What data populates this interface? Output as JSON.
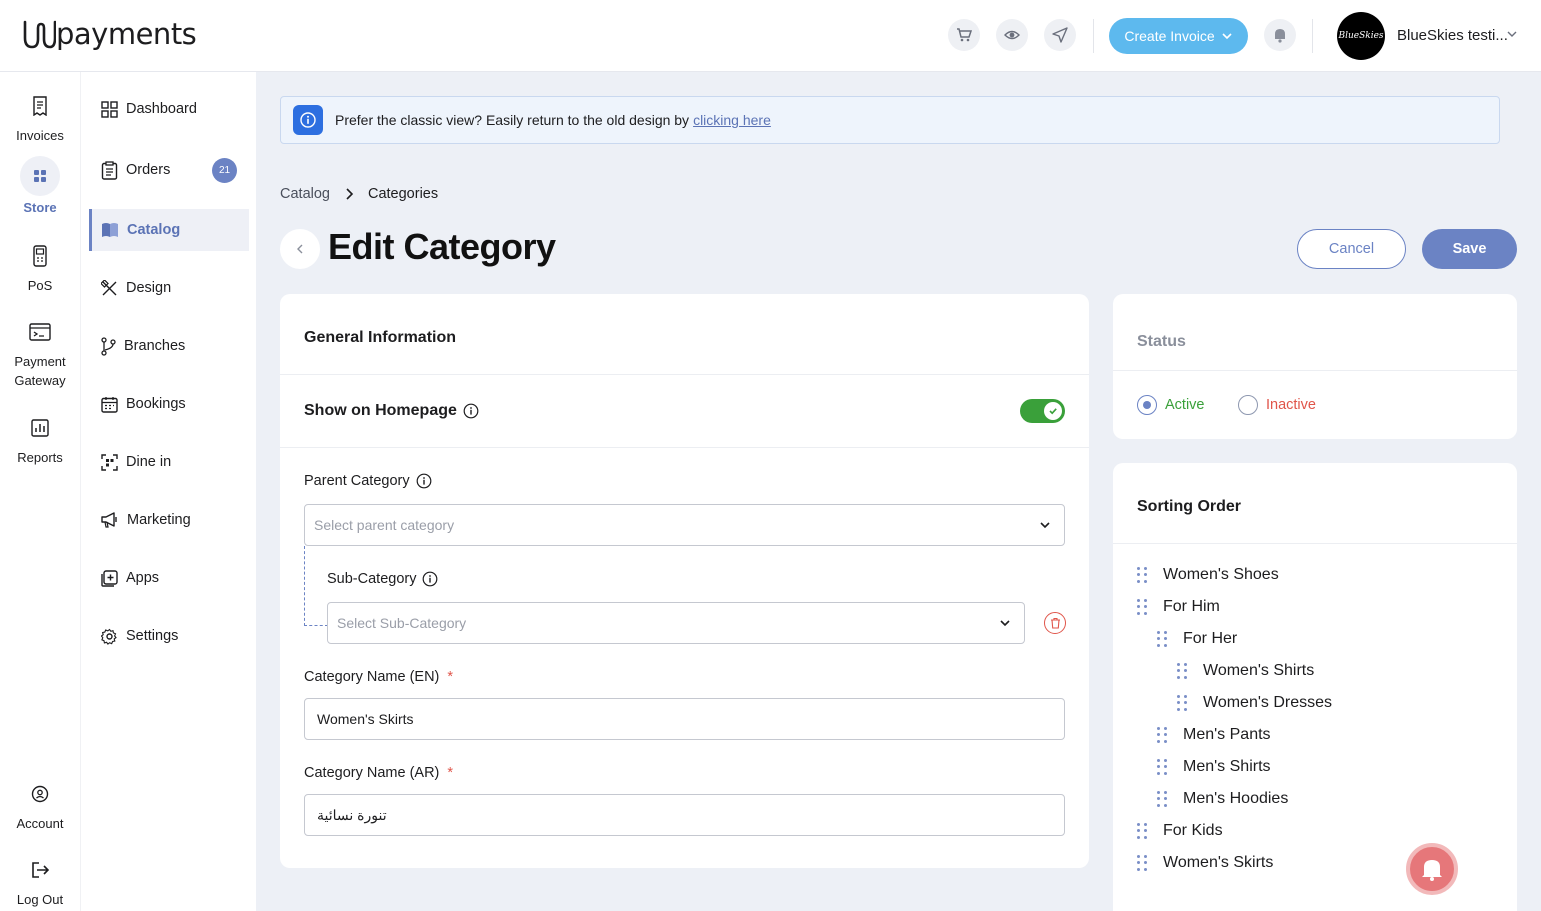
{
  "brand": {
    "name": "payments"
  },
  "header": {
    "create_invoice_label": "Create Invoice",
    "avatar_text": "BlueSkies",
    "user_name": "BlueSkies testi..."
  },
  "rail": {
    "items": [
      {
        "label": "Invoices"
      },
      {
        "label": "Store",
        "active": true
      },
      {
        "label": "PoS"
      },
      {
        "label": "Payment Gateway"
      },
      {
        "label": "Reports"
      },
      {
        "label": "Account"
      },
      {
        "label": "Log Out"
      }
    ]
  },
  "nav": {
    "items": [
      {
        "label": "Dashboard"
      },
      {
        "label": "Orders",
        "badge": "21"
      },
      {
        "label": "Catalog",
        "active": true
      },
      {
        "label": "Design"
      },
      {
        "label": "Branches"
      },
      {
        "label": "Bookings"
      },
      {
        "label": "Dine in"
      },
      {
        "label": "Marketing"
      },
      {
        "label": "Apps"
      },
      {
        "label": "Settings"
      }
    ]
  },
  "banner": {
    "text": "Prefer the classic view? Easily return to the old design by",
    "link": "clicking here"
  },
  "breadcrumb": {
    "parent": "Catalog",
    "current": "Categories"
  },
  "page": {
    "title": "Edit Category",
    "cancel_label": "Cancel",
    "save_label": "Save"
  },
  "general": {
    "title": "General Information",
    "show_on_homepage_label": "Show on Homepage",
    "show_on_homepage": true,
    "parent_category_label": "Parent Category",
    "parent_category_placeholder": "Select parent category",
    "sub_category_label": "Sub-Category",
    "sub_category_placeholder": "Select Sub-Category",
    "name_en_label": "Category Name (EN)",
    "name_en_value": "Women's Skirts",
    "name_ar_label": "Category Name (AR)",
    "name_ar_value": "تنورة نسائية",
    "required_mark": "*"
  },
  "status": {
    "title": "Status",
    "options": [
      {
        "label": "Active",
        "selected": true,
        "color": "#3aa03a"
      },
      {
        "label": "Inactive",
        "selected": false,
        "color": "#e0554a"
      }
    ]
  },
  "sorting": {
    "title": "Sorting Order",
    "items": [
      {
        "label": "Women's Shoes",
        "level": 0
      },
      {
        "label": "For Him",
        "level": 0
      },
      {
        "label": "For Her",
        "level": 1
      },
      {
        "label": "Women's Shirts",
        "level": 2
      },
      {
        "label": "Women's Dresses",
        "level": 2
      },
      {
        "label": "Men's Pants",
        "level": 1
      },
      {
        "label": "Men's Shirts",
        "level": 1
      },
      {
        "label": "Men's Hoodies",
        "level": 1
      },
      {
        "label": "For Kids",
        "level": 0
      },
      {
        "label": "Women's Skirts",
        "level": 0
      }
    ]
  },
  "colors": {
    "accent": "#6b83c4",
    "primary_button": "#5db9ee",
    "toggle_on": "#3aa03a",
    "danger": "#e0554a"
  }
}
